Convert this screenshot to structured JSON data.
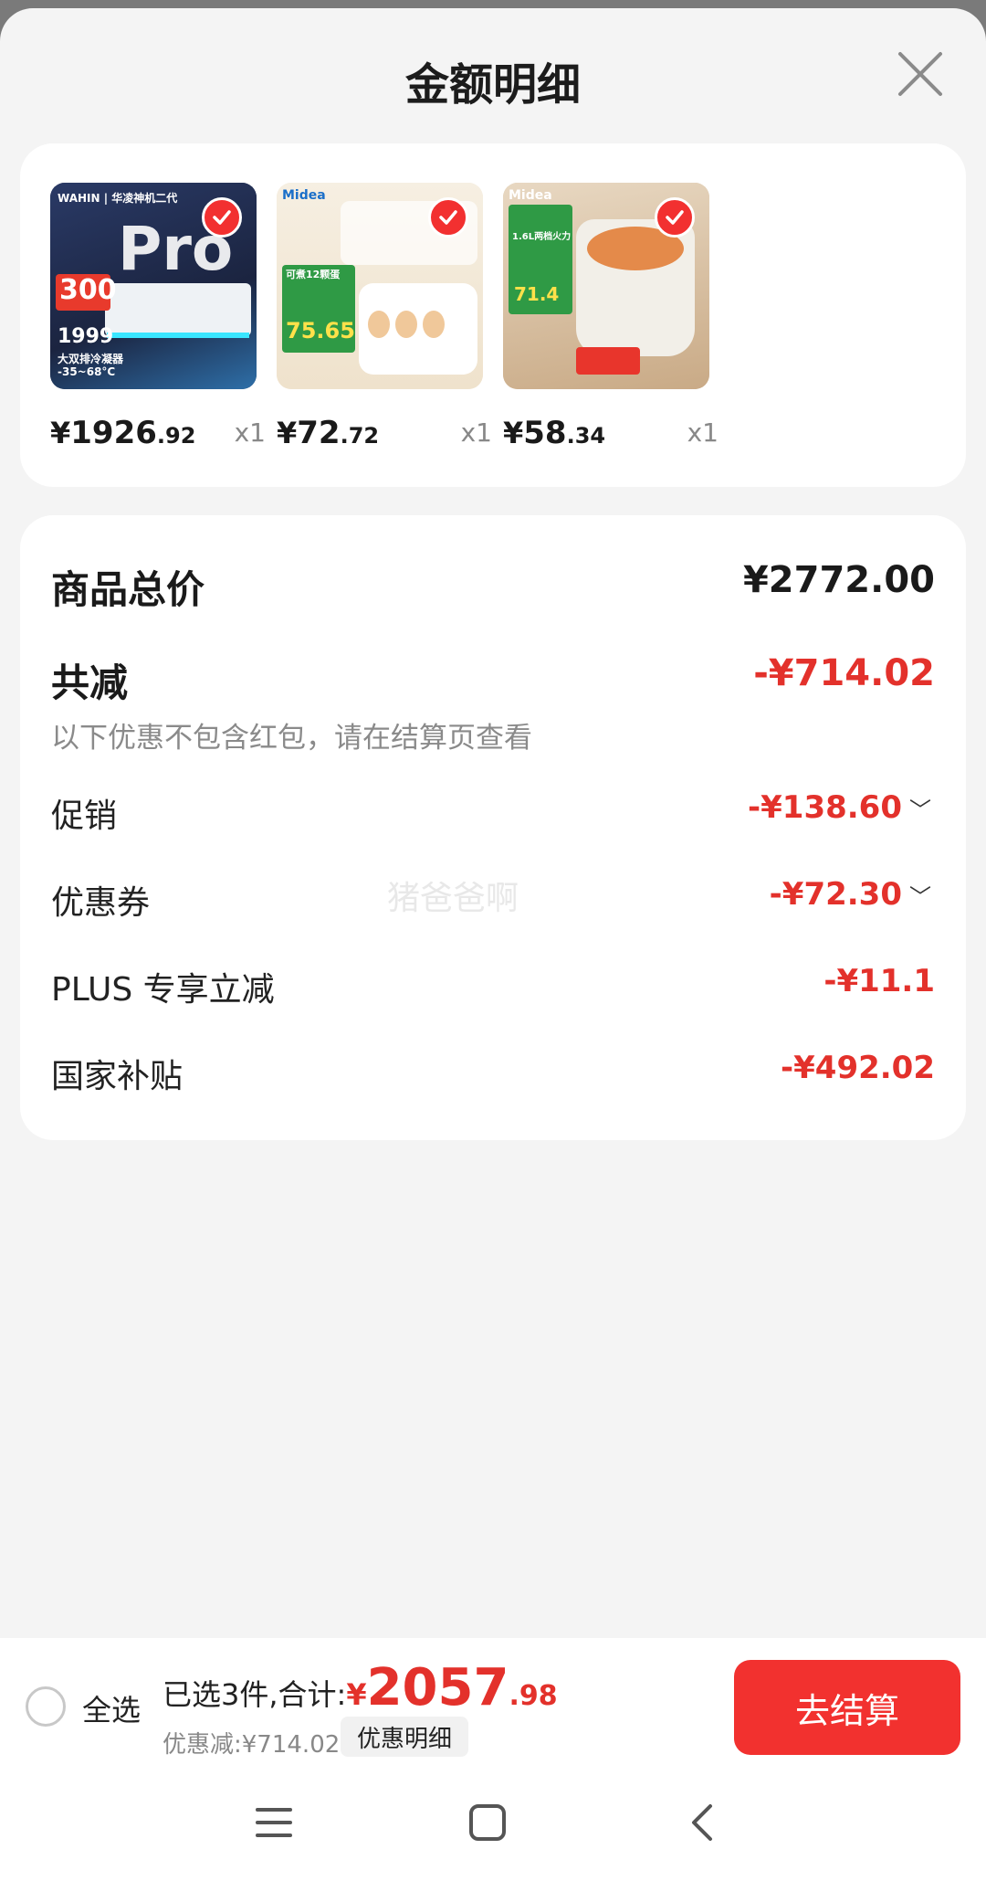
{
  "header": {
    "title": "金额明细",
    "close_icon": "close-icon"
  },
  "products": [
    {
      "price_yen": "¥",
      "price_int": "1926",
      "price_dec": ".92",
      "qty": "x1",
      "thumb_color": "#24324f",
      "thumb_brand": "WAHIN | 华凌神机二代",
      "thumb_big": "Pro",
      "thumb_price": "1999",
      "thumb_note": "300",
      "thumb_sub": "大双排冷凝器",
      "thumb_temp": "-35~68°C"
    },
    {
      "price_yen": "¥",
      "price_int": "72",
      "price_dec": ".72",
      "qty": "x1",
      "thumb_color": "#f3e9d6",
      "thumb_brand": "Midea",
      "thumb_price": "75.65",
      "thumb_sub": "可煮12颗蛋"
    },
    {
      "price_yen": "¥",
      "price_int": "58",
      "price_dec": ".34",
      "qty": "x1",
      "thumb_color": "#d9c3a5",
      "thumb_brand": "Midea",
      "thumb_price": "71.4",
      "thumb_sub": "1.6L两档火力"
    }
  ],
  "summary": {
    "total_label": "商品总价",
    "total_value": "¥2772.00",
    "reduce_label": "共减",
    "reduce_value": "-¥714.02",
    "note": "以下优惠不包含红包，请在结算页查看",
    "items": [
      {
        "label": "促销",
        "value": "-¥138.60",
        "chevron": "﹀"
      },
      {
        "label": "优惠券",
        "value": "-¥72.30",
        "chevron": "﹀"
      },
      {
        "label": "PLUS 专享立减",
        "value": "-¥11.1",
        "chevron": ""
      },
      {
        "label": "国家补贴",
        "value": "-¥492.02",
        "chevron": ""
      }
    ],
    "watermark": "猪爸爸啊"
  },
  "bottom_bar": {
    "select_all": "全选",
    "selected_label": "已选3件,合计:",
    "total_yen": "¥",
    "total_int": "2057",
    "total_dec": ".98",
    "discount_text": "优惠减:¥714.02",
    "detail_chip": "优惠明细",
    "checkout": "去结算"
  },
  "colors": {
    "accent": "#f2312f",
    "price_red": "#e3312b"
  },
  "nav": {
    "menu_icon": "menu-icon",
    "home_icon": "home-icon",
    "back_icon": "back-icon"
  }
}
